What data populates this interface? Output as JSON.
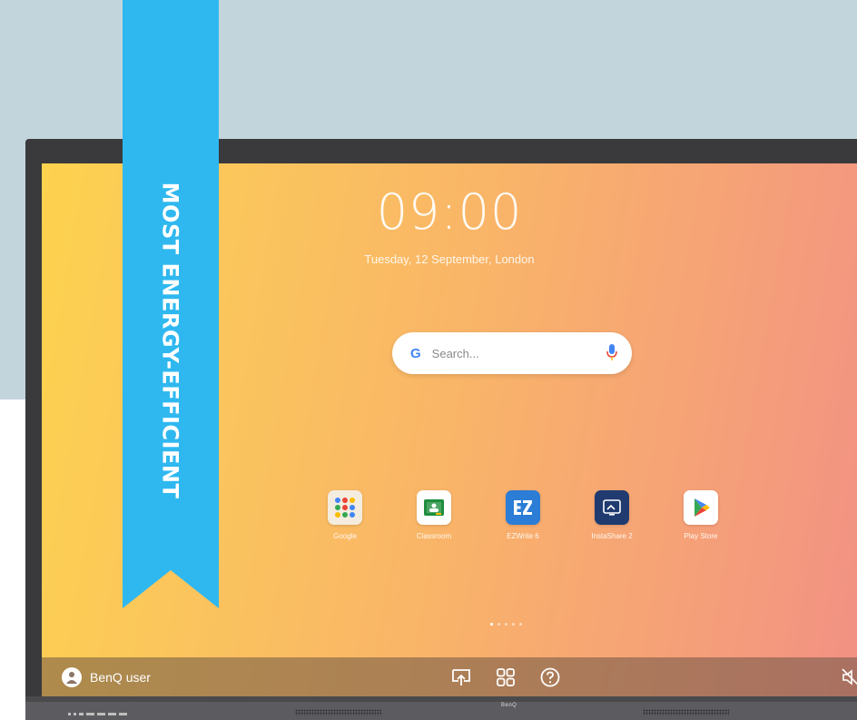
{
  "ribbon": {
    "text": "MOST ENERGY-EFFICIENT",
    "color": "#2fb8f0"
  },
  "screen": {
    "clock": "09:00",
    "date": "Tuesday, 12 September, London",
    "search": {
      "logo": "G",
      "placeholder": "Search..."
    },
    "apps": [
      {
        "label": "Google",
        "icon": "google-apps-folder-icon"
      },
      {
        "label": "Classroom",
        "icon": "classroom-icon"
      },
      {
        "label": "EZWrite 6",
        "icon": "ezwrite-icon"
      },
      {
        "label": "InstaShare 2",
        "icon": "instashare-icon"
      },
      {
        "label": "Play Store",
        "icon": "play-store-icon"
      }
    ],
    "pages": {
      "total": 5,
      "current": 1
    }
  },
  "taskbar": {
    "user_name": "BenQ user",
    "icons": [
      "screen-share-icon",
      "apps-grid-icon",
      "help-icon",
      "mute-icon"
    ]
  },
  "bezel": {
    "brand": "BenQ"
  }
}
